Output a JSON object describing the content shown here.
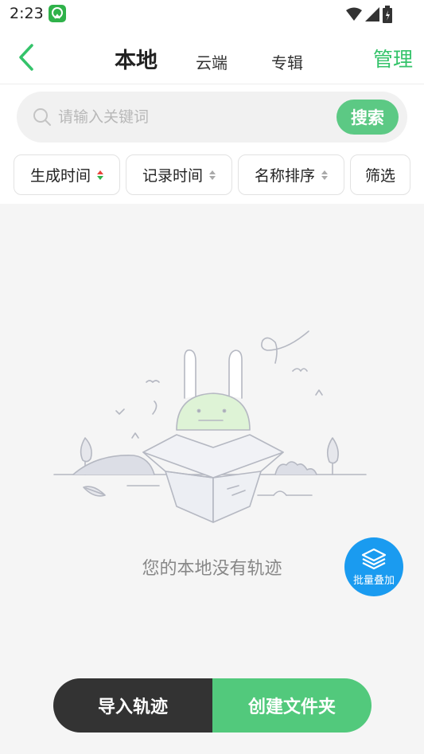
{
  "status_bar": {
    "time": "2:23"
  },
  "nav": {
    "active_tab": "本地",
    "tabs": [
      "云端",
      "专辑"
    ],
    "manage": "管理"
  },
  "search": {
    "placeholder": "请输入关键词",
    "button": "搜索"
  },
  "filters": [
    {
      "label": "生成时间"
    },
    {
      "label": "记录时间"
    },
    {
      "label": "名称排序"
    },
    {
      "label": "筛选"
    }
  ],
  "empty": {
    "message": "您的本地没有轨迹"
  },
  "batch": {
    "label": "批量叠加"
  },
  "actions": {
    "import": "导入轨迹",
    "create_folder": "创建文件夹"
  },
  "colors": {
    "accent_green": "#34c36a",
    "button_green": "#52c97c",
    "dark": "#333333",
    "float_blue": "#1a9bf0"
  }
}
